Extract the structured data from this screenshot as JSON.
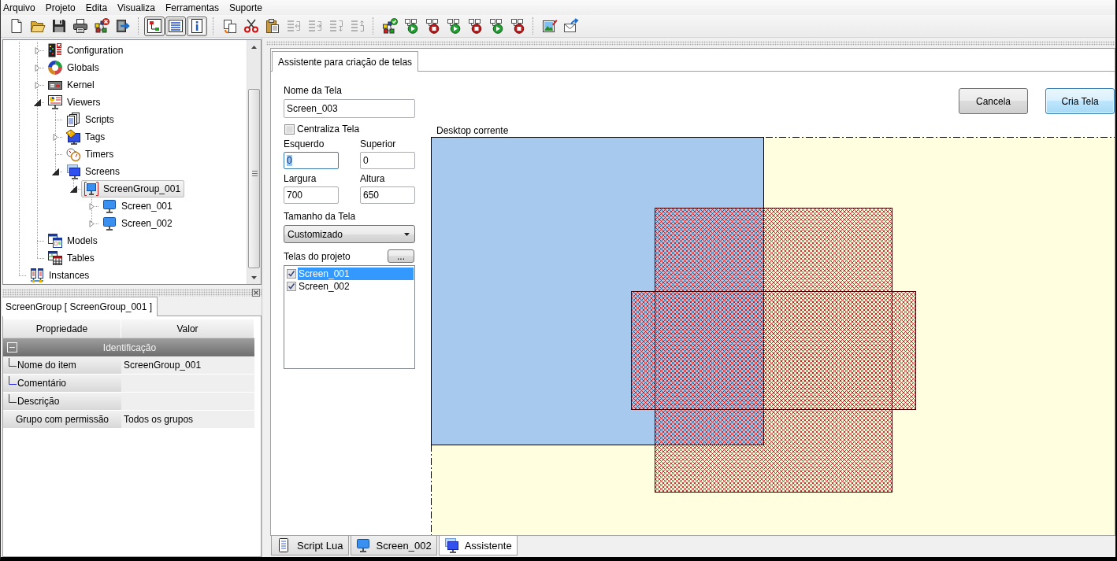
{
  "menu": [
    "Arquivo",
    "Projeto",
    "Edita",
    "Visualiza",
    "Ferramentas",
    "Suporte"
  ],
  "toolbar": [
    [
      {
        "pressed": false,
        "disabled": false
      },
      {
        "pressed": false,
        "disabled": false
      },
      {
        "pressed": false,
        "disabled": false
      },
      {
        "pressed": false,
        "disabled": false
      },
      {
        "pressed": false,
        "disabled": false
      },
      {
        "pressed": false,
        "disabled": false
      }
    ],
    [
      {
        "pressed": true,
        "disabled": false
      },
      {
        "pressed": true,
        "disabled": false
      },
      {
        "pressed": true,
        "disabled": false
      }
    ],
    [
      {
        "pressed": false,
        "disabled": false
      },
      {
        "pressed": false,
        "disabled": false
      },
      {
        "pressed": false,
        "disabled": false
      },
      {
        "pressed": false,
        "disabled": true
      },
      {
        "pressed": false,
        "disabled": true
      },
      {
        "pressed": false,
        "disabled": true
      },
      {
        "pressed": false,
        "disabled": true
      }
    ],
    [
      {
        "pressed": false,
        "disabled": false
      },
      {
        "pressed": false,
        "disabled": false
      },
      {
        "pressed": false,
        "disabled": false
      },
      {
        "pressed": false,
        "disabled": false
      },
      {
        "pressed": false,
        "disabled": false
      },
      {
        "pressed": false,
        "disabled": false
      },
      {
        "pressed": false,
        "disabled": false
      }
    ],
    [
      {
        "pressed": false,
        "disabled": false
      },
      {
        "pressed": false,
        "disabled": false
      }
    ]
  ],
  "project_tree": {
    "items": [
      {
        "children": [
          {
            "label": "Configuration",
            "kind": "config",
            "expandable": true,
            "expanded": false,
            "selected": false
          },
          {
            "label": "Globals",
            "kind": "globals",
            "expandable": true,
            "expanded": false,
            "selected": false
          },
          {
            "label": "Kernel",
            "kind": "kernel",
            "expandable": true,
            "expanded": false,
            "selected": false
          },
          {
            "label": "Viewers",
            "kind": "viewers",
            "expandable": true,
            "expanded": true,
            "selected": false,
            "children": [
              {
                "label": "Scripts",
                "kind": "scripts",
                "expandable": false,
                "selected": false
              },
              {
                "label": "Tags",
                "kind": "tags",
                "expandable": true,
                "expanded": false,
                "selected": false
              },
              {
                "label": "Timers",
                "kind": "timers",
                "expandable": false,
                "selected": false
              },
              {
                "label": "Screens",
                "kind": "screens",
                "expandable": true,
                "expanded": true,
                "selected": false,
                "children": [
                  {
                    "label": "ScreenGroup_001",
                    "kind": "group",
                    "expandable": true,
                    "expanded": true,
                    "selected": true,
                    "children": [
                      {
                        "label": "Screen_001",
                        "kind": "screen",
                        "expandable": true,
                        "expanded": false,
                        "selected": false
                      },
                      {
                        "label": "Screen_002",
                        "kind": "screen",
                        "expandable": true,
                        "expanded": false,
                        "selected": false
                      }
                    ]
                  }
                ]
              }
            ]
          },
          {
            "label": "Models",
            "kind": "models",
            "expandable": false,
            "selected": false
          },
          {
            "label": "Tables",
            "kind": "tables",
            "expandable": false,
            "selected": false
          }
        ]
      },
      {
        "label": "Instances",
        "kind": "instances",
        "expandable": false,
        "selected": false
      }
    ]
  },
  "properties": {
    "tab": "ScreenGroup [ ScreenGroup_001 ]",
    "columns": [
      "Propriedade",
      "Valor"
    ],
    "groups": [
      {
        "title": "Identificação",
        "expanded": true,
        "rows": [
          {
            "property": "Nome do item",
            "value": "ScreenGroup_001"
          },
          {
            "property": "Comentário"
          },
          {
            "property": "Descrição"
          }
        ]
      }
    ],
    "rows": [
      {
        "property": "Grupo com permissão",
        "value": "Todos os grupos"
      }
    ]
  },
  "editor": {
    "tab": "Assistente para criação de telas",
    "form": {
      "name": {
        "label": "Nome da Tela",
        "value": "Screen_003",
        "focused": false
      },
      "center": {
        "label": "Centraliza Tela",
        "checked": false
      },
      "position": [
        {
          "label": "Esquerdo",
          "value": "0",
          "focused": true
        },
        {
          "label": "Superior",
          "value": "0",
          "focused": false
        },
        {
          "label": "Largura",
          "value": "700",
          "focused": false
        },
        {
          "label": "Altura",
          "value": "650",
          "focused": false
        }
      ],
      "size": {
        "label": "Tamanho da Tela",
        "value": "Customizado"
      },
      "screens": {
        "label": "Telas do projeto",
        "button": "...",
        "items": [
          {
            "label": "Screen_001",
            "checked": true,
            "selected": true
          },
          {
            "label": "Screen_002",
            "checked": true,
            "selected": false
          }
        ]
      }
    },
    "buttons": [
      {
        "label": "Cancela",
        "default": false
      },
      {
        "label": "Cria Tela",
        "default": true
      }
    ],
    "preview": {
      "label": "Desktop corrente"
    }
  },
  "document_tabs": [
    {
      "label": "Script Lua",
      "kind": "script",
      "selected": false
    },
    {
      "label": "Screen_002",
      "kind": "screen",
      "selected": false
    },
    {
      "label": "Assistente",
      "kind": "wizard",
      "selected": true
    }
  ]
}
